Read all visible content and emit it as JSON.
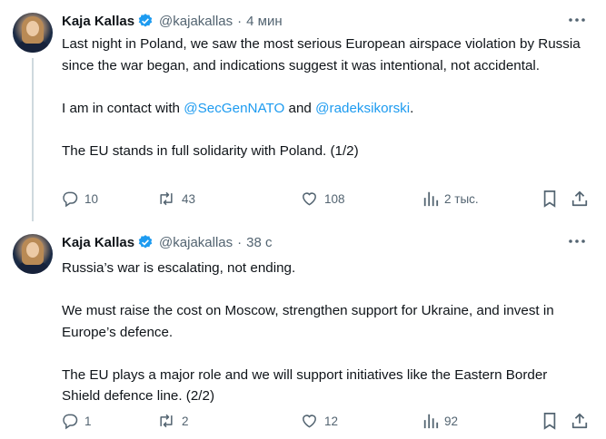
{
  "tweets": [
    {
      "author": {
        "name": "Kaja Kallas",
        "handle": "@kajakallas",
        "verified": true
      },
      "time": "4 мин",
      "paragraphs": [
        {
          "text": "Last night in Poland, we saw the most serious European airspace violation by Russia since the war began, and indications suggest it was intentional, not accidental."
        },
        {
          "before": "I am in contact with ",
          "mention1": "@SecGenNATO",
          "middle": " and ",
          "mention2": "@radeksikorski",
          "after": "."
        },
        {
          "text": "The EU stands in full solidarity with Poland. (1/2)"
        }
      ],
      "stats": {
        "replies": "10",
        "reposts": "43",
        "likes": "108",
        "views": "2 тыс."
      }
    },
    {
      "author": {
        "name": "Kaja Kallas",
        "handle": "@kajakallas",
        "verified": true
      },
      "time": "38 с",
      "paragraphs": [
        {
          "text": "Russia’s war is escalating, not ending."
        },
        {
          "text": "We must raise the cost on Moscow, strengthen support for Ukraine, and invest in Europe’s defence."
        },
        {
          "text": "The EU plays a major role and we will support initiatives like the Eastern Border Shield defence line. (2/2)"
        }
      ],
      "stats": {
        "replies": "1",
        "reposts": "2",
        "likes": "12",
        "views": "92"
      }
    }
  ],
  "colors": {
    "text": "#0f1419",
    "secondary": "#536471",
    "link": "#1d9bf0",
    "verified": "#1d9bf0"
  },
  "icons": [
    "reply-icon",
    "repost-icon",
    "like-icon",
    "views-icon",
    "bookmark-icon",
    "share-icon",
    "more-icon",
    "verified-badge-icon"
  ]
}
